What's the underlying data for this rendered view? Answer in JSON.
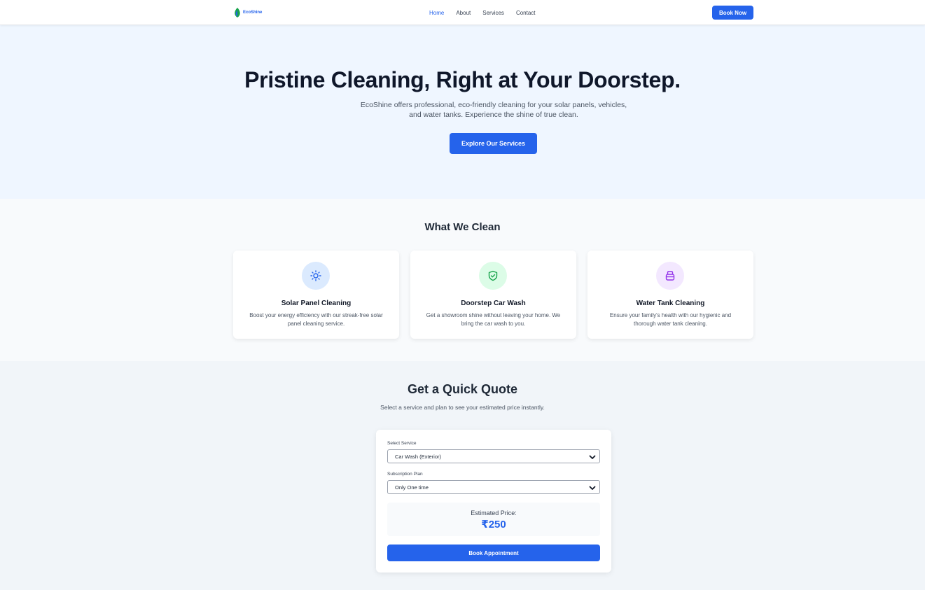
{
  "header": {
    "logo_text": "EcoShine",
    "nav": [
      {
        "label": "Home",
        "active": true
      },
      {
        "label": "About",
        "active": false
      },
      {
        "label": "Services",
        "active": false
      },
      {
        "label": "Contact",
        "active": false
      }
    ],
    "book_now_label": "Book Now"
  },
  "hero": {
    "title": "Pristine Cleaning, Right at Your Doorstep.",
    "subtitle": "EcoShine offers professional, eco-friendly cleaning for your solar panels, vehicles, and water tanks. Experience the shine of true clean.",
    "cta_label": "Explore Our Services"
  },
  "services": {
    "title": "What We Clean",
    "cards": [
      {
        "icon": "sun-icon",
        "title": "Solar Panel Cleaning",
        "description": "Boost your energy efficiency with our streak-free solar panel cleaning service."
      },
      {
        "icon": "shield-check-icon",
        "title": "Doorstep Car Wash",
        "description": "Get a showroom shine without leaving your home. We bring the car wash to you."
      },
      {
        "icon": "water-tank-icon",
        "title": "Water Tank Cleaning",
        "description": "Ensure your family's health with our hygienic and thorough water tank cleaning."
      }
    ]
  },
  "quote": {
    "title": "Get a Quick Quote",
    "subtitle": "Select a service and plan to see your estimated price instantly.",
    "service_label": "Select Service",
    "service_value": "Car Wash (Exterior)",
    "plan_label": "Subscription Plan",
    "plan_value": "Only One time",
    "price_label": "Estimated Price:",
    "price_value": "₹250",
    "book_label": "Book Appointment"
  },
  "colors": {
    "accent": "#2563eb",
    "hero_bg": "#eff6ff",
    "solar_icon_bg": "#dbeafe",
    "car_icon_bg": "#dcfce7",
    "tank_icon_bg": "#f3e8ff"
  }
}
